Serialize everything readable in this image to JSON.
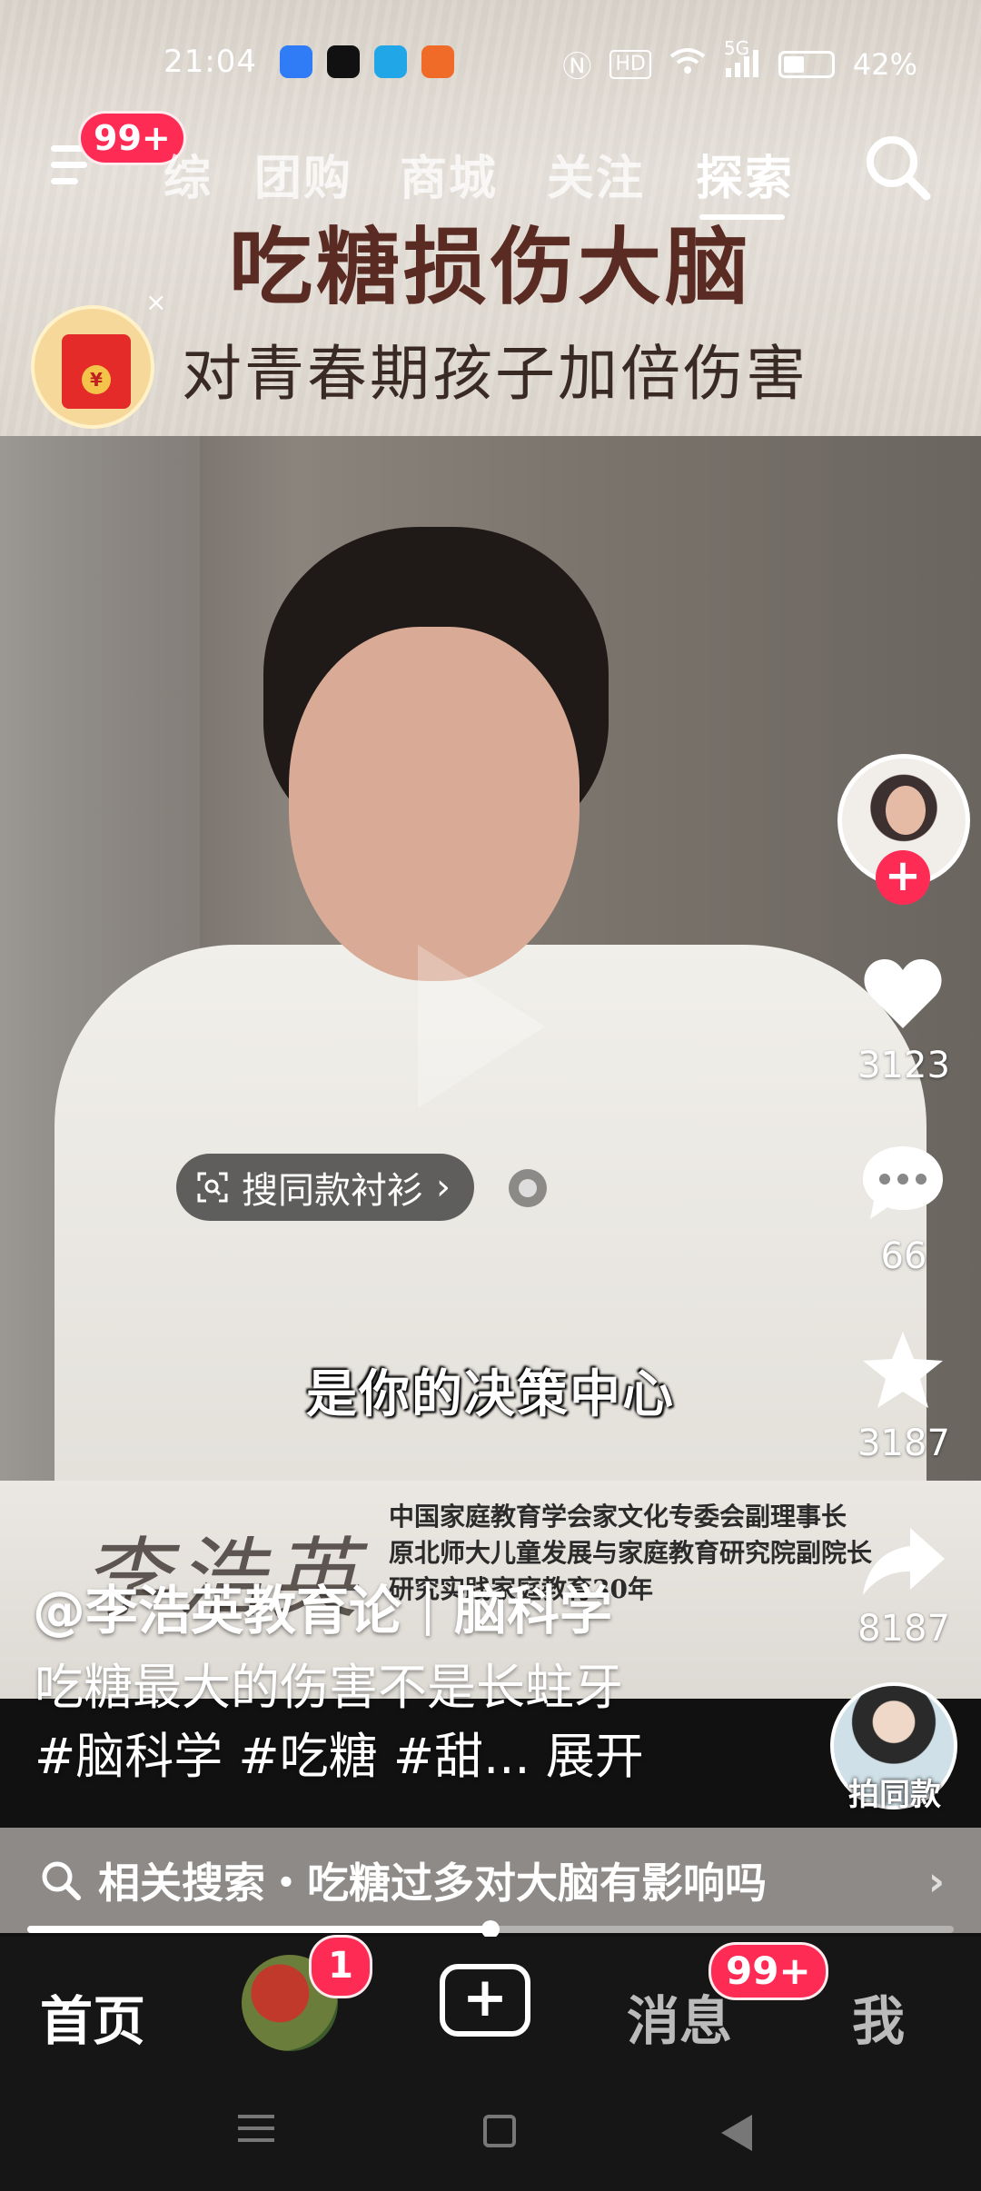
{
  "status_bar": {
    "time": "21:04",
    "battery": "42%",
    "network": "5G",
    "hd": "HD",
    "app_icon_colors": [
      "#2f7cf6",
      "#111111",
      "#21a7e8",
      "#f06a28"
    ]
  },
  "top_nav": {
    "menu_badge": "99+",
    "tabs": [
      "综",
      "团购",
      "商城",
      "关注",
      "探索"
    ],
    "active_tab": "探索"
  },
  "banner": {
    "title": "吃糖损伤大脑",
    "subtitle": "对青春期孩子加倍伤害",
    "close": "×",
    "coin": "¥"
  },
  "video": {
    "product_tag": "搜同款衬衫",
    "product_tag_chevron": "›",
    "subtitle": "是你的决策中心",
    "signature": "李浩英",
    "credits": [
      "中国家庭教育学会家文化专委会副理事长",
      "原北师大儿童发展与家庭教育研究院副院长",
      "研究实践家庭教育30年"
    ]
  },
  "rail": {
    "follow": "+",
    "likes": "3123",
    "comments": "66",
    "favorites": "3187",
    "shares": "8187"
  },
  "caption": {
    "author": "@李浩英教育论｜脑科学",
    "text": "吃糖最大的伤害不是长蛀牙",
    "tags": "#脑科学 #吃糖 #甜...",
    "expand": "展开",
    "remix_label": "拍同款"
  },
  "related_search": {
    "text": "相关搜索・吃糖过多对大脑有影响吗",
    "chevron": "›"
  },
  "progress": {
    "played_fraction": 0.5
  },
  "tabbar": {
    "home": "首页",
    "friends_badge": "1",
    "create": "+",
    "messages": "消息",
    "messages_badge": "99+",
    "me": "我"
  },
  "colors": {
    "accent": "#fe2c55",
    "banner_title": "#5a2b22"
  }
}
